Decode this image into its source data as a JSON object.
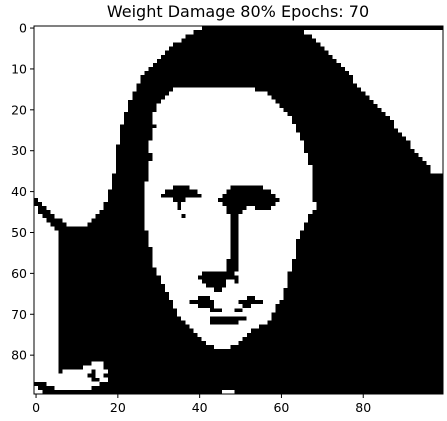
{
  "chart_data": {
    "type": "heatmap",
    "title": "Weight Damage 80% Epochs: 70",
    "xlabel": "",
    "ylabel": "",
    "grid": false,
    "colormap": "binary",
    "colors": {
      "on": "#000000",
      "off": "#ffffff",
      "axes": "#000000",
      "background": "#ffffff"
    },
    "value_range": [
      0,
      1
    ],
    "xlim": [
      -0.5,
      99.5
    ],
    "ylim": [
      89.5,
      -0.5
    ],
    "x_ticks": [
      0,
      20,
      40,
      60,
      80
    ],
    "x_tick_labels": [
      "0",
      "20",
      "40",
      "60",
      "80"
    ],
    "y_ticks": [
      0,
      10,
      20,
      30,
      40,
      50,
      60,
      70,
      80
    ],
    "y_tick_labels": [
      "0",
      "10",
      "20",
      "30",
      "40",
      "50",
      "60",
      "70",
      "80"
    ],
    "grid_size": {
      "rows": 90,
      "cols": 100
    },
    "description_of_values": "1 = black pixel, 0 = white pixel; each row listed as [start_col, end_col] runs of white pixels (inclusive), all other cells black",
    "white_runs": [
      [
        [
          0,
          40
        ]
      ],
      [
        [
          0,
          38
        ],
        [
          66,
          99
        ]
      ],
      [
        [
          0,
          36
        ],
        [
          68,
          99
        ]
      ],
      [
        [
          0,
          35
        ],
        [
          69,
          99
        ]
      ],
      [
        [
          0,
          33
        ],
        [
          70,
          99
        ]
      ],
      [
        [
          0,
          32
        ],
        [
          71,
          99
        ]
      ],
      [
        [
          0,
          31
        ],
        [
          72,
          99
        ]
      ],
      [
        [
          0,
          30
        ],
        [
          73,
          99
        ]
      ],
      [
        [
          0,
          29
        ],
        [
          74,
          99
        ]
      ],
      [
        [
          0,
          28
        ],
        [
          75,
          99
        ]
      ],
      [
        [
          0,
          27
        ],
        [
          76,
          99
        ]
      ],
      [
        [
          0,
          26
        ],
        [
          77,
          99
        ]
      ],
      [
        [
          0,
          25
        ],
        [
          78,
          99
        ]
      ],
      [
        [
          0,
          25
        ],
        [
          78,
          99
        ]
      ],
      [
        [
          0,
          24
        ],
        [
          79,
          99
        ]
      ],
      [
        [
          0,
          24
        ],
        [
          34,
          53
        ],
        [
          80,
          99
        ]
      ],
      [
        [
          0,
          23
        ],
        [
          33,
          56
        ],
        [
          81,
          99
        ]
      ],
      [
        [
          0,
          23
        ],
        [
          32,
          57
        ],
        [
          82,
          99
        ]
      ],
      [
        [
          0,
          22
        ],
        [
          31,
          58
        ],
        [
          83,
          99
        ]
      ],
      [
        [
          0,
          22
        ],
        [
          30,
          59
        ],
        [
          84,
          99
        ]
      ],
      [
        [
          0,
          22
        ],
        [
          30,
          60
        ],
        [
          85,
          99
        ]
      ],
      [
        [
          0,
          21
        ],
        [
          29,
          61
        ],
        [
          86,
          99
        ]
      ],
      [
        [
          0,
          21
        ],
        [
          29,
          62
        ],
        [
          87,
          99
        ]
      ],
      [
        [
          0,
          21
        ],
        [
          29,
          62
        ],
        [
          88,
          99
        ]
      ],
      [
        [
          0,
          20
        ],
        [
          30,
          63
        ],
        [
          88,
          99
        ]
      ],
      [
        [
          0,
          20
        ],
        [
          29,
          63
        ],
        [
          89,
          99
        ]
      ],
      [
        [
          0,
          20
        ],
        [
          29,
          64
        ],
        [
          90,
          99
        ]
      ],
      [
        [
          0,
          20
        ],
        [
          29,
          64
        ],
        [
          91,
          99
        ]
      ],
      [
        [
          0,
          20
        ],
        [
          28,
          65
        ],
        [
          92,
          99
        ]
      ],
      [
        [
          0,
          19
        ],
        [
          28,
          65
        ],
        [
          92,
          99
        ]
      ],
      [
        [
          0,
          19
        ],
        [
          28,
          65
        ],
        [
          93,
          99
        ]
      ],
      [
        [
          0,
          19
        ],
        [
          29,
          66
        ],
        [
          94,
          99
        ]
      ],
      [
        [
          0,
          19
        ],
        [
          29,
          66
        ],
        [
          95,
          99
        ]
      ],
      [
        [
          0,
          19
        ],
        [
          28,
          66
        ],
        [
          96,
          99
        ]
      ],
      [
        [
          0,
          19
        ],
        [
          28,
          67
        ],
        [
          97,
          99
        ]
      ],
      [
        [
          0,
          19
        ],
        [
          28,
          67
        ],
        [
          97,
          99
        ]
      ],
      [
        [
          0,
          18
        ],
        [
          28,
          67
        ]
      ],
      [
        [
          0,
          18
        ],
        [
          28,
          67
        ]
      ],
      [
        [
          0,
          18
        ],
        [
          27,
          67
        ]
      ],
      [
        [
          0,
          18
        ],
        [
          27,
          33
        ],
        [
          38,
          47
        ],
        [
          56,
          67
        ]
      ],
      [
        [
          0,
          17
        ],
        [
          27,
          31
        ],
        [
          40,
          46
        ],
        [
          58,
          67
        ]
      ],
      [
        [
          0,
          17
        ],
        [
          27,
          30
        ],
        [
          41,
          45
        ],
        [
          59,
          67
        ]
      ],
      [
        [
          1,
          17
        ],
        [
          27,
          33
        ],
        [
          37,
          44
        ],
        [
          60,
          67
        ]
      ],
      [
        [
          2,
          16
        ],
        [
          27,
          34
        ],
        [
          36,
          45
        ],
        [
          59,
          68
        ]
      ],
      [
        [
          0,
          0
        ],
        [
          3,
          16
        ],
        [
          27,
          34
        ],
        [
          36,
          46
        ],
        [
          52,
          53
        ],
        [
          58,
          68
        ]
      ],
      [
        [
          0,
          0
        ],
        [
          4,
          15
        ],
        [
          27,
          46
        ],
        [
          51,
          67
        ]
      ],
      [
        [
          0,
          1
        ],
        [
          5,
          14
        ],
        [
          27,
          35
        ],
        [
          37,
          47
        ],
        [
          50,
          66
        ]
      ],
      [
        [
          0,
          2
        ],
        [
          7,
          13
        ],
        [
          27,
          47
        ],
        [
          50,
          66
        ]
      ],
      [
        [
          0,
          3
        ],
        [
          8,
          12
        ],
        [
          27,
          47
        ],
        [
          50,
          65
        ]
      ],
      [
        [
          0,
          4
        ],
        [
          27,
          47
        ],
        [
          50,
          65
        ]
      ],
      [
        [
          0,
          5
        ],
        [
          28,
          47
        ],
        [
          50,
          64
        ]
      ],
      [
        [
          0,
          5
        ],
        [
          28,
          47
        ],
        [
          50,
          64
        ]
      ],
      [
        [
          0,
          5
        ],
        [
          28,
          47
        ],
        [
          50,
          63
        ]
      ],
      [
        [
          0,
          5
        ],
        [
          28,
          47
        ],
        [
          50,
          63
        ]
      ],
      [
        [
          0,
          5
        ],
        [
          29,
          47
        ],
        [
          50,
          63
        ]
      ],
      [
        [
          0,
          5
        ],
        [
          29,
          47
        ],
        [
          50,
          63
        ]
      ],
      [
        [
          0,
          5
        ],
        [
          29,
          47
        ],
        [
          50,
          63
        ]
      ],
      [
        [
          0,
          5
        ],
        [
          29,
          46
        ],
        [
          50,
          62
        ]
      ],
      [
        [
          0,
          5
        ],
        [
          29,
          46
        ],
        [
          50,
          62
        ]
      ],
      [
        [
          0,
          5
        ],
        [
          30,
          46
        ],
        [
          50,
          62
        ]
      ],
      [
        [
          0,
          5
        ],
        [
          30,
          40
        ],
        [
          49,
          61
        ]
      ],
      [
        [
          0,
          5
        ],
        [
          31,
          39
        ],
        [
          50,
          61
        ]
      ],
      [
        [
          0,
          5
        ],
        [
          31,
          40
        ],
        [
          47,
          48
        ],
        [
          50,
          61
        ]
      ],
      [
        [
          0,
          5
        ],
        [
          32,
          41
        ],
        [
          47,
          61
        ]
      ],
      [
        [
          0,
          5
        ],
        [
          32,
          43
        ],
        [
          46,
          60
        ]
      ],
      [
        [
          0,
          5
        ],
        [
          33,
          60
        ]
      ],
      [
        [
          0,
          5
        ],
        [
          33,
          39
        ],
        [
          43,
          51
        ],
        [
          54,
          60
        ]
      ],
      [
        [
          0,
          5
        ],
        [
          34,
          37
        ],
        [
          44,
          49
        ],
        [
          56,
          59
        ]
      ],
      [
        [
          0,
          5
        ],
        [
          34,
          39
        ],
        [
          44,
          50
        ],
        [
          53,
          58
        ]
      ],
      [
        [
          0,
          5
        ],
        [
          35,
          42
        ],
        [
          46,
          48
        ],
        [
          51,
          58
        ]
      ],
      [
        [
          0,
          5
        ],
        [
          35,
          57
        ]
      ],
      [
        [
          0,
          5
        ],
        [
          36,
          42
        ],
        [
          52,
          57
        ]
      ],
      [
        [
          0,
          5
        ],
        [
          37,
          42
        ],
        [
          50,
          56
        ]
      ],
      [
        [
          0,
          5
        ],
        [
          38,
          54
        ]
      ],
      [
        [
          0,
          5
        ],
        [
          39,
          52
        ]
      ],
      [
        [
          0,
          5
        ],
        [
          40,
          51
        ]
      ],
      [
        [
          0,
          5
        ],
        [
          41,
          50
        ]
      ],
      [
        [
          0,
          5
        ],
        [
          42,
          49
        ]
      ],
      [
        [
          0,
          5
        ],
        [
          44,
          47
        ]
      ],
      [
        [
          0,
          5
        ]
      ],
      [
        [
          0,
          5
        ]
      ],
      [
        [
          0,
          5
        ]
      ],
      [
        [
          0,
          5
        ],
        [
          14,
          16
        ]
      ],
      [
        [
          0,
          5
        ],
        [
          12,
          16
        ]
      ],
      [
        [
          0,
          5
        ],
        [
          7,
          13
        ],
        [
          15,
          17
        ]
      ],
      [
        [
          0,
          5
        ],
        [
          6,
          12
        ],
        [
          15,
          16
        ]
      ],
      [
        [
          0,
          5
        ],
        [
          5,
          13
        ],
        [
          16,
          17
        ]
      ],
      [
        [
          3,
          15
        ]
      ],
      [
        [
          0,
          0
        ],
        [
          5,
          13
        ]
      ],
      [
        [
          0,
          1
        ],
        [
          46,
          48
        ]
      ]
    ]
  }
}
